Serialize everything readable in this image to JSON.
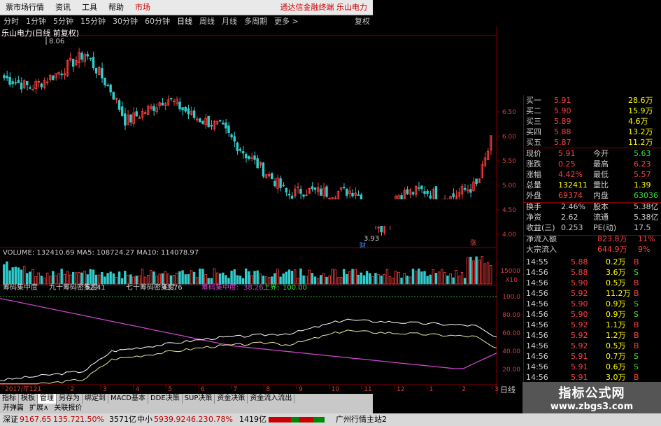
{
  "menubar": {
    "items": [
      "票市场行情",
      "资讯",
      "工具",
      "帮助"
    ],
    "market": "市场",
    "ad": "通达信金融终端  乐山电力"
  },
  "periods": {
    "items": [
      "分时",
      "1分钟",
      "5分钟",
      "15分钟",
      "30分钟",
      "60分钟",
      "日线",
      "周线",
      "月线",
      "多周期",
      "更多 >"
    ],
    "selected": "日线",
    "right_label": "复权"
  },
  "stock": {
    "title": "乐山电力(日线 前复权)",
    "high_label": "8.06",
    "low_label": "3.93"
  },
  "price_axis": [
    "6.50",
    "6.00",
    "5.50",
    "5.00",
    "4.50",
    "4.00"
  ],
  "volume": {
    "text": "VOLUME: 132410.69  MA5: 108724.27  MA10: 114078.97",
    "axis": [
      "15000",
      "X10"
    ]
  },
  "chip": {
    "name": "筹码集中度",
    "items": [
      {
        "label": "九十筹码密集度:",
        "value": "52.41"
      },
      {
        "label": "七十筹码密集度:",
        "value": "43.76"
      },
      {
        "label": "筹码集中度:",
        "value": "38.26"
      },
      {
        "label": "上界:",
        "value": "100.00"
      }
    ],
    "axis": [
      "100.0",
      "80.00",
      "60.00",
      "40.00",
      "20.00"
    ]
  },
  "date_axis": [
    "2017/年12",
    "1",
    "2",
    "3",
    "4",
    "5",
    "6",
    "7",
    "8",
    "9",
    "10",
    "11",
    "12",
    "1",
    "2",
    "3"
  ],
  "markers": {
    "cai": "财",
    "zhang": "涨"
  },
  "quote": {
    "bids": [
      {
        "name": "买一",
        "price": "5.91",
        "vol": "28.6万"
      },
      {
        "name": "买二",
        "price": "5.90",
        "vol": "15.9万"
      },
      {
        "name": "买三",
        "price": "5.89",
        "vol": "4.6万"
      },
      {
        "name": "买四",
        "price": "5.88",
        "vol": "13.2万"
      },
      {
        "name": "买五",
        "price": "5.87",
        "vol": "11.2万"
      }
    ],
    "stats": [
      {
        "l1": "现价",
        "v1": "5.91",
        "l2": "今开",
        "v2": "5.63"
      },
      {
        "l1": "涨跌",
        "v1": "0.25",
        "l2": "最高",
        "v2": "6.23"
      },
      {
        "l1": "涨幅",
        "v1": "4.42%",
        "l2": "最低",
        "v2": "5.57"
      },
      {
        "l1": "总量",
        "v1": "132411",
        "l2": "量比",
        "v2": "1.39"
      },
      {
        "l1": "外盘",
        "v1": "69374",
        "l2": "内盘",
        "v2": "63036"
      }
    ],
    "stats2": [
      {
        "l1": "换手",
        "v1": "2.46%",
        "l2": "股本",
        "v2": "5.38亿"
      },
      {
        "l1": "净资",
        "v1": "2.62",
        "l2": "流通",
        "v2": "5.38亿"
      },
      {
        "l1": "收益(三)",
        "v1": "0.253",
        "l2": "PE(动)",
        "v2": "17.5"
      }
    ],
    "flows": [
      {
        "label": "净流入额",
        "value": "823.8万",
        "pct": "11%"
      },
      {
        "label": "大宗流入",
        "value": "644.9万",
        "pct": "9%"
      }
    ],
    "ticks": [
      {
        "t": "14:55",
        "p": "5.88",
        "v": "0.2万",
        "d": "B"
      },
      {
        "t": "14:56",
        "p": "5.88",
        "v": "3.6万",
        "d": "S"
      },
      {
        "t": "14:56",
        "p": "5.90",
        "v": "0.5万",
        "d": "B"
      },
      {
        "t": "14:56",
        "p": "5.92",
        "v": "11.2万",
        "d": "B"
      },
      {
        "t": "14:56",
        "p": "5.90",
        "v": "0.9万",
        "d": "S"
      },
      {
        "t": "14:56",
        "p": "5.90",
        "v": "0.9万",
        "d": "S"
      },
      {
        "t": "14:56",
        "p": "5.92",
        "v": "1.1万",
        "d": "B"
      },
      {
        "t": "14:56",
        "p": "5.92",
        "v": "1.2万",
        "d": "B"
      },
      {
        "t": "14:56",
        "p": "5.92",
        "v": "0.5万",
        "d": "B"
      },
      {
        "t": "14:56",
        "p": "5.91",
        "v": "0.7万",
        "d": "S"
      },
      {
        "t": "14:56",
        "p": "5.91",
        "v": "0.6万",
        "d": "S"
      },
      {
        "t": "14:56",
        "p": "5.91",
        "v": "3.0万",
        "d": "B"
      },
      {
        "t": "14:56",
        "p": "5.91",
        "v": "0.9万",
        "d": "B"
      }
    ]
  },
  "bottom_tabs": [
    "指标",
    "模板",
    "管理",
    "另存为",
    "绑定到",
    "MACD基本",
    "DDE决策",
    "SUP决策",
    "资金决策",
    "资金流入流出"
  ],
  "bottom_tabs_selected": "管理",
  "bottom_tabs2": [
    "开弹篇",
    "扩展∧",
    "关联报价"
  ],
  "right_bottom": {
    "period": "日线",
    "plus": "+",
    "minus": "-"
  },
  "status": {
    "sh_name": "深证",
    "sh_val": "9167.65",
    "sh_chg": "135.72",
    "sh_pct": "1.50%",
    "sh_amt": "3571亿",
    "zx_name": "中小",
    "zx_val": "5939.92",
    "zx_chg": "46.23",
    "zx_pct": "0.78%",
    "zx_amt": "1419亿",
    "host": "广州行情主站2"
  },
  "watermark": {
    "line1": "指标公式网",
    "line2": "www.zbgs3.com"
  },
  "colors": {
    "up": "#ff4040",
    "down": "#33cccc",
    "purple": "#cc44cc",
    "white": "#ffffff",
    "yellow": "#e8e8a0"
  }
}
